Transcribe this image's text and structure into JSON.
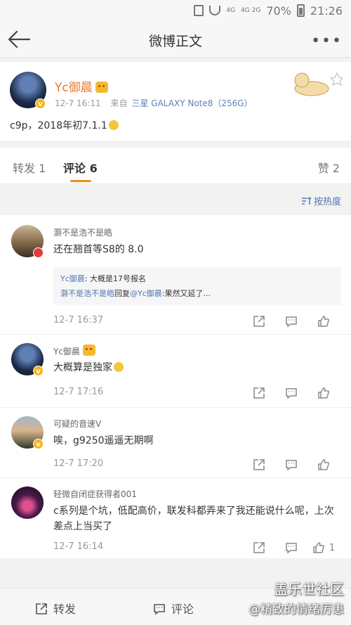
{
  "status_bar": {
    "network": "4G",
    "network2": "4G 2G",
    "battery": "70%",
    "time": "21:26"
  },
  "nav": {
    "title": "微博正文"
  },
  "post": {
    "author": "Yc御晨",
    "time": "12-7 16:11",
    "source_prefix": "来自",
    "source": "三星 GALAXY Note8（256G）",
    "text": "c9p，2018年初7.1.1"
  },
  "tabs": {
    "repost": "转发 1",
    "comments": "评论 6",
    "likes": "赞 2"
  },
  "sort": {
    "label": "按热度"
  },
  "comments": [
    {
      "name": "灏不是浩不是皓",
      "text": "还在翘首等S8的 8.0",
      "quote": {
        "line1_user": "Yc御晨",
        "line1_text": ": 大概是17号报名",
        "line2_user": "灏不是浩不是皓",
        "line2_mid": "回复",
        "line2_mention": "@Yc御晨",
        "line2_text": ":果然又延了..."
      },
      "time": "12-7 16:37",
      "likes": ""
    },
    {
      "name": "Yc御晨",
      "text": "大概算是独家",
      "time": "12-7 17:16",
      "likes": ""
    },
    {
      "name": "可疑的音速V",
      "text": "唉，g9250遥遥无期啊",
      "time": "12-7 17:20",
      "likes": ""
    },
    {
      "name": "轻微自闭症获得者001",
      "text": "c系列是个坑，低配高价，联发科都弄来了我还能说什么呢，上次差点上当买了",
      "time": "12-7 16:14",
      "likes": "1"
    }
  ],
  "bottom_bar": {
    "repost": "转发",
    "comment": "评论"
  },
  "watermark": {
    "line1": "盖乐世社区",
    "line2": "@精致的情绪厉患"
  },
  "colors": {
    "username": "#e8762c",
    "link": "#4e77b0",
    "tab_underline": "#f58a1f",
    "vip_badge": "#f6b51e"
  }
}
